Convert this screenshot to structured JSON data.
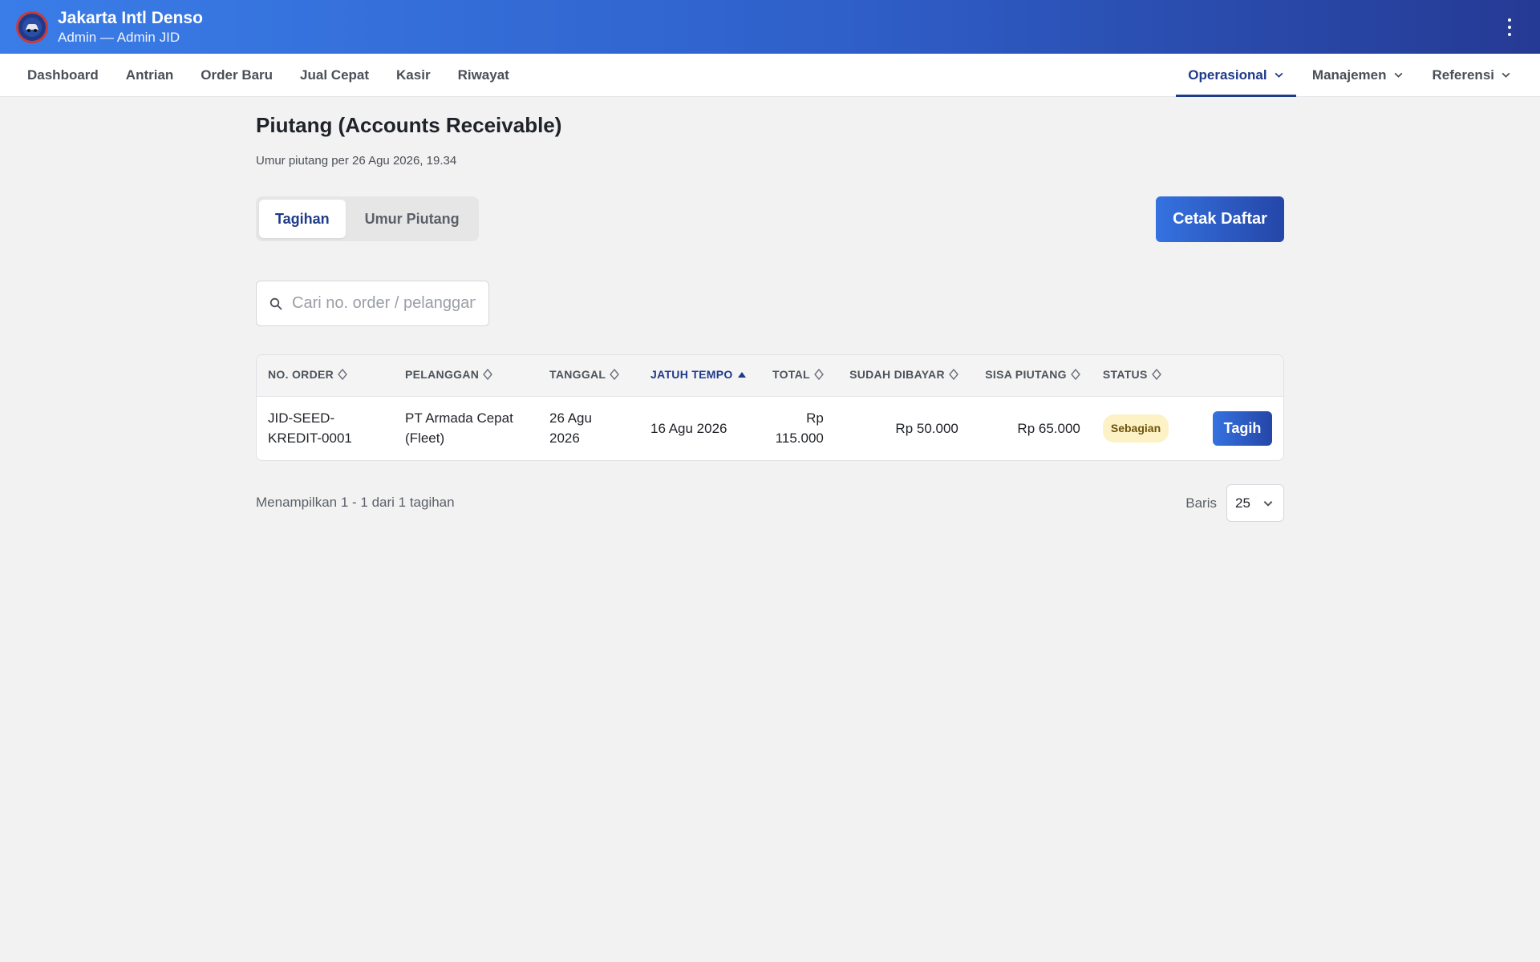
{
  "header": {
    "brand_name": "Jakarta Intl Denso",
    "brand_sub": "Admin — Admin JID"
  },
  "nav": {
    "items": [
      {
        "label": "Dashboard"
      },
      {
        "label": "Antrian"
      },
      {
        "label": "Order Baru"
      },
      {
        "label": "Jual Cepat"
      },
      {
        "label": "Kasir"
      },
      {
        "label": "Riwayat"
      }
    ],
    "dropdowns": [
      {
        "label": "Operasional",
        "active": true
      },
      {
        "label": "Manajemen"
      },
      {
        "label": "Referensi"
      }
    ]
  },
  "page": {
    "title": "Piutang (Accounts Receivable)",
    "subtitle": "Umur piutang per 26 Agu 2026, 19.34"
  },
  "tabs": [
    {
      "label": "Tagihan",
      "active": true
    },
    {
      "label": "Umur Piutang"
    }
  ],
  "print_label": "Cetak Daftar",
  "search": {
    "placeholder": "Cari no. order / pelanggan",
    "value": ""
  },
  "table": {
    "columns": [
      {
        "label": "NO. ORDER"
      },
      {
        "label": "PELANGGAN"
      },
      {
        "label": "TANGGAL"
      },
      {
        "label": "JATUH TEMPO",
        "sort": "asc"
      },
      {
        "label": "TOTAL"
      },
      {
        "label": "SUDAH DIBAYAR"
      },
      {
        "label": "SISA PIUTANG"
      },
      {
        "label": "STATUS"
      }
    ],
    "rows": [
      {
        "order": "JID-SEED-KREDIT-0001",
        "order_l1": "JID-SEED-",
        "order_l2": "KREDIT-0001",
        "customer_l1": "PT Armada Cepat",
        "customer_l2": "(Fleet)",
        "date_l1": "26 Agu",
        "date_l2": "2026",
        "due": "16 Agu 2026",
        "total_l1": "Rp",
        "total_l2": "115.000",
        "paid": "Rp 50.000",
        "remaining": "Rp 65.000",
        "status": "Sebagian",
        "action": "Tagih"
      }
    ]
  },
  "footer": {
    "info": "Menampilkan 1 - 1 dari 1 tagihan",
    "rows_label": "Baris",
    "rows_value": "25"
  },
  "colors": {
    "primary": "#1e3a8a",
    "header_start": "#3a7de8",
    "header_end": "#253a94",
    "badge_bg": "#fdf1c6"
  }
}
